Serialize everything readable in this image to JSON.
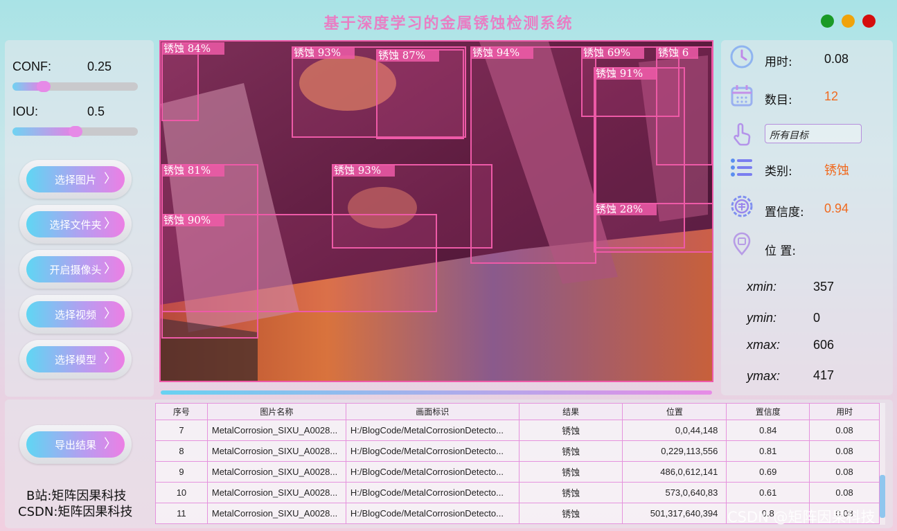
{
  "title": "基于深度学习的金属锈蚀检测系统",
  "params": {
    "conf_label": "CONF:",
    "conf_value": "0.25",
    "conf_level": 0.25,
    "iou_label": "IOU:",
    "iou_value": "0.5",
    "iou_level": 0.5
  },
  "buttons": {
    "select_image": "选择图片",
    "select_folder": "选择文件夹",
    "open_camera": "开启摄像头",
    "select_video": "选择视频",
    "select_model": "选择模型",
    "export": "导出结果",
    "chevron": "〉"
  },
  "info": {
    "time_label": "用时:",
    "time_value": "0.08",
    "count_label": "数目:",
    "count_value": "12",
    "target_select": "所有目标",
    "class_label": "类别:",
    "class_value": "锈蚀",
    "conf_label": "置信度:",
    "conf_value": "0.94",
    "pos_label": "位 置:",
    "xmin_label": "xmin:",
    "xmin_value": "357",
    "ymin_label": "ymin:",
    "ymin_value": "0",
    "xmax_label": "xmax:",
    "xmax_value": "606",
    "ymax_label": "ymax:",
    "ymax_value": "417"
  },
  "detections": [
    {
      "label": "锈蚀 84%"
    },
    {
      "label": "锈蚀 93%"
    },
    {
      "label": "锈蚀 87%"
    },
    {
      "label": "锈蚀 94%"
    },
    {
      "label": "锈蚀 69%"
    },
    {
      "label": "锈蚀 6"
    },
    {
      "label": "锈蚀 91%"
    },
    {
      "label": "锈蚀 81%"
    },
    {
      "label": "锈蚀 93%"
    },
    {
      "label": "锈蚀 90%"
    },
    {
      "label": "锈蚀 28%"
    }
  ],
  "table": {
    "headers": [
      "序号",
      "图片名称",
      "画面标识",
      "结果",
      "位置",
      "置信度",
      "用时"
    ],
    "rows": [
      [
        "7",
        "MetalCorrosion_SIXU_A0028...",
        "H:/BlogCode/MetalCorrosionDetecto...",
        "锈蚀",
        "0,0,44,148",
        "0.84",
        "0.08"
      ],
      [
        "8",
        "MetalCorrosion_SIXU_A0028...",
        "H:/BlogCode/MetalCorrosionDetecto...",
        "锈蚀",
        "0,229,113,556",
        "0.81",
        "0.08"
      ],
      [
        "9",
        "MetalCorrosion_SIXU_A0028...",
        "H:/BlogCode/MetalCorrosionDetecto...",
        "锈蚀",
        "486,0,612,141",
        "0.69",
        "0.08"
      ],
      [
        "10",
        "MetalCorrosion_SIXU_A0028...",
        "H:/BlogCode/MetalCorrosionDetecto...",
        "锈蚀",
        "573,0,640,83",
        "0.61",
        "0.08"
      ],
      [
        "11",
        "MetalCorrosion_SIXU_A0028...",
        "H:/BlogCode/MetalCorrosionDetecto...",
        "锈蚀",
        "501,317,640,394",
        "0.8",
        "0.08"
      ]
    ]
  },
  "credits": {
    "bilibili": "B站:矩阵因果科技",
    "csdn": "CSDN:矩阵因果科技"
  },
  "watermark": "CSDN @矩阵因果科技",
  "colors": {
    "title": "#e87fc4",
    "accent_pink": "#ee5aa8",
    "value_orange": "#f06a1f"
  }
}
